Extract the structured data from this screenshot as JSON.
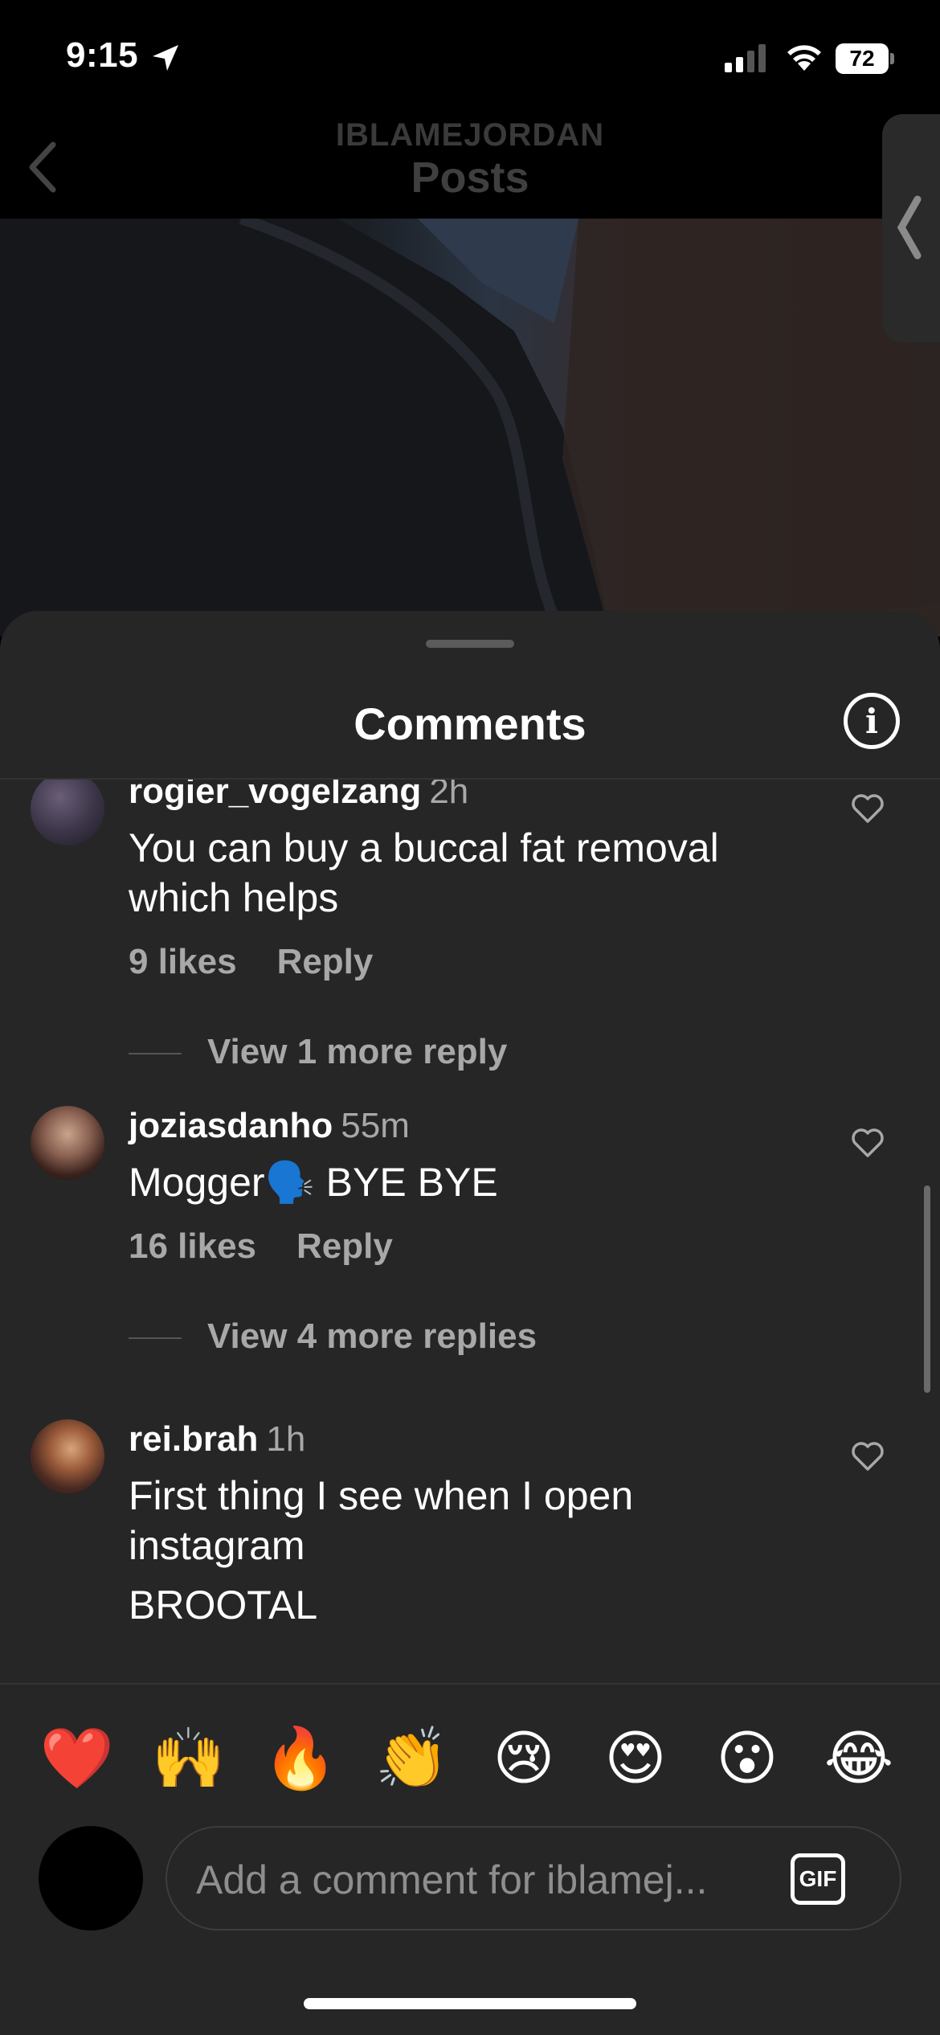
{
  "status_bar": {
    "time": "9:15",
    "battery": "72"
  },
  "header": {
    "account": "IBLAMEJORDAN",
    "title": "Posts"
  },
  "sheet": {
    "title": "Comments"
  },
  "comments": [
    {
      "username": "rogier_vogelzang",
      "time": "2h",
      "lines": [
        "You can buy a buccal fat removal",
        "which helps"
      ],
      "likes": "9 likes",
      "reply": "Reply",
      "view_more": "View 1 more reply"
    },
    {
      "username": "joziasdanho",
      "time": "55m",
      "lines": [
        "Mogger🗣️ BYE BYE"
      ],
      "likes": "16 likes",
      "reply": "Reply",
      "view_more": "View 4 more replies"
    },
    {
      "username": "rei.brah",
      "time": "1h",
      "lines": [
        "First thing I see when I open",
        "instagram",
        "BROOTAL"
      ]
    }
  ],
  "emoji_bar": [
    "❤️",
    "🙌",
    "🔥",
    "👏",
    "😢",
    "😍",
    "😮",
    "😂"
  ],
  "composer": {
    "placeholder": "Add a comment for iblamej...",
    "gif_label": "GIF"
  }
}
